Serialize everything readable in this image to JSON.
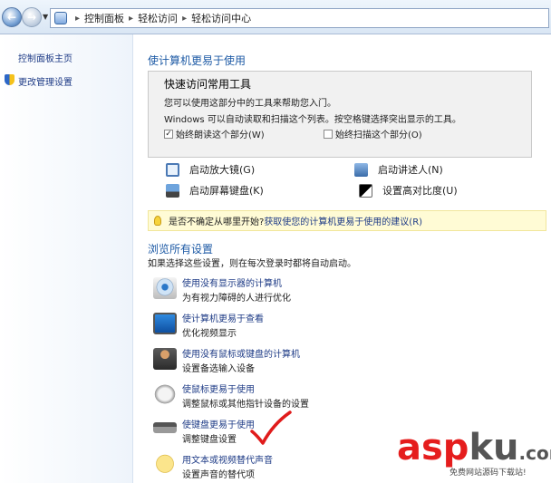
{
  "address_bar": {
    "crumbs": [
      "控制面板",
      "轻松访问",
      "轻松访问中心"
    ]
  },
  "sidebar": {
    "items": [
      {
        "label": "控制面板主页"
      },
      {
        "label": "更改管理设置"
      }
    ]
  },
  "main": {
    "heading": "使计算机更易于使用",
    "quick_tools": {
      "title": "快速访问常用工具",
      "desc1": "您可以使用这部分中的工具来帮助您入门。",
      "desc2": "Windows 可以自动读取和扫描这个列表。按空格键选择突出显示的工具。",
      "always_read": {
        "label": "始终朗读这个部分(W)",
        "checked": true
      },
      "always_scan": {
        "label": "始终扫描这个部分(O)",
        "checked": false
      },
      "tools": [
        {
          "label": "启动放大镜(G)",
          "icon": "magnifier-icon"
        },
        {
          "label": "启动讲述人(N)",
          "icon": "narrator-icon"
        },
        {
          "label": "启动屏幕键盘(K)",
          "icon": "on-screen-keyboard-icon"
        },
        {
          "label": "设置高对比度(U)",
          "icon": "high-contrast-icon"
        }
      ]
    },
    "tip": {
      "text": "是否不确定从哪里开始?",
      "link": "获取使您的计算机更易于使用的建议(R)"
    },
    "browse": {
      "heading": "浏览所有设置",
      "subtitle": "如果选择这些设置，则在每次登录时都将自动启动。",
      "items": [
        {
          "link": "使用没有显示器的计算机",
          "desc": "为有视力障碍的人进行优化",
          "icon": "eye-icon"
        },
        {
          "link": "使计算机更易于查看",
          "desc": "优化视频显示",
          "icon": "monitor-icon"
        },
        {
          "link": "使用没有鼠标或键盘的计算机",
          "desc": "设置备选输入设备",
          "icon": "user-icon"
        },
        {
          "link": "使鼠标更易于使用",
          "desc": "调整鼠标或其他指针设备的设置",
          "icon": "mouse-icon"
        },
        {
          "link": "使键盘更易于使用",
          "desc": "调整键盘设置",
          "icon": "keyboard-icon"
        },
        {
          "link": "用文本或视频替代声音",
          "desc": "设置声音的替代项",
          "icon": "speech-bubble-icon"
        }
      ]
    }
  },
  "watermark": {
    "brand_a": "asp",
    "brand_b": "ku",
    "brand_c": ".com",
    "slogan": "免费网站源码下载站!"
  },
  "colors": {
    "link": "#1e3b86",
    "heading": "#1d5aa5",
    "tip_bg": "#fffbd5",
    "check_mark": "#e01b1b"
  }
}
